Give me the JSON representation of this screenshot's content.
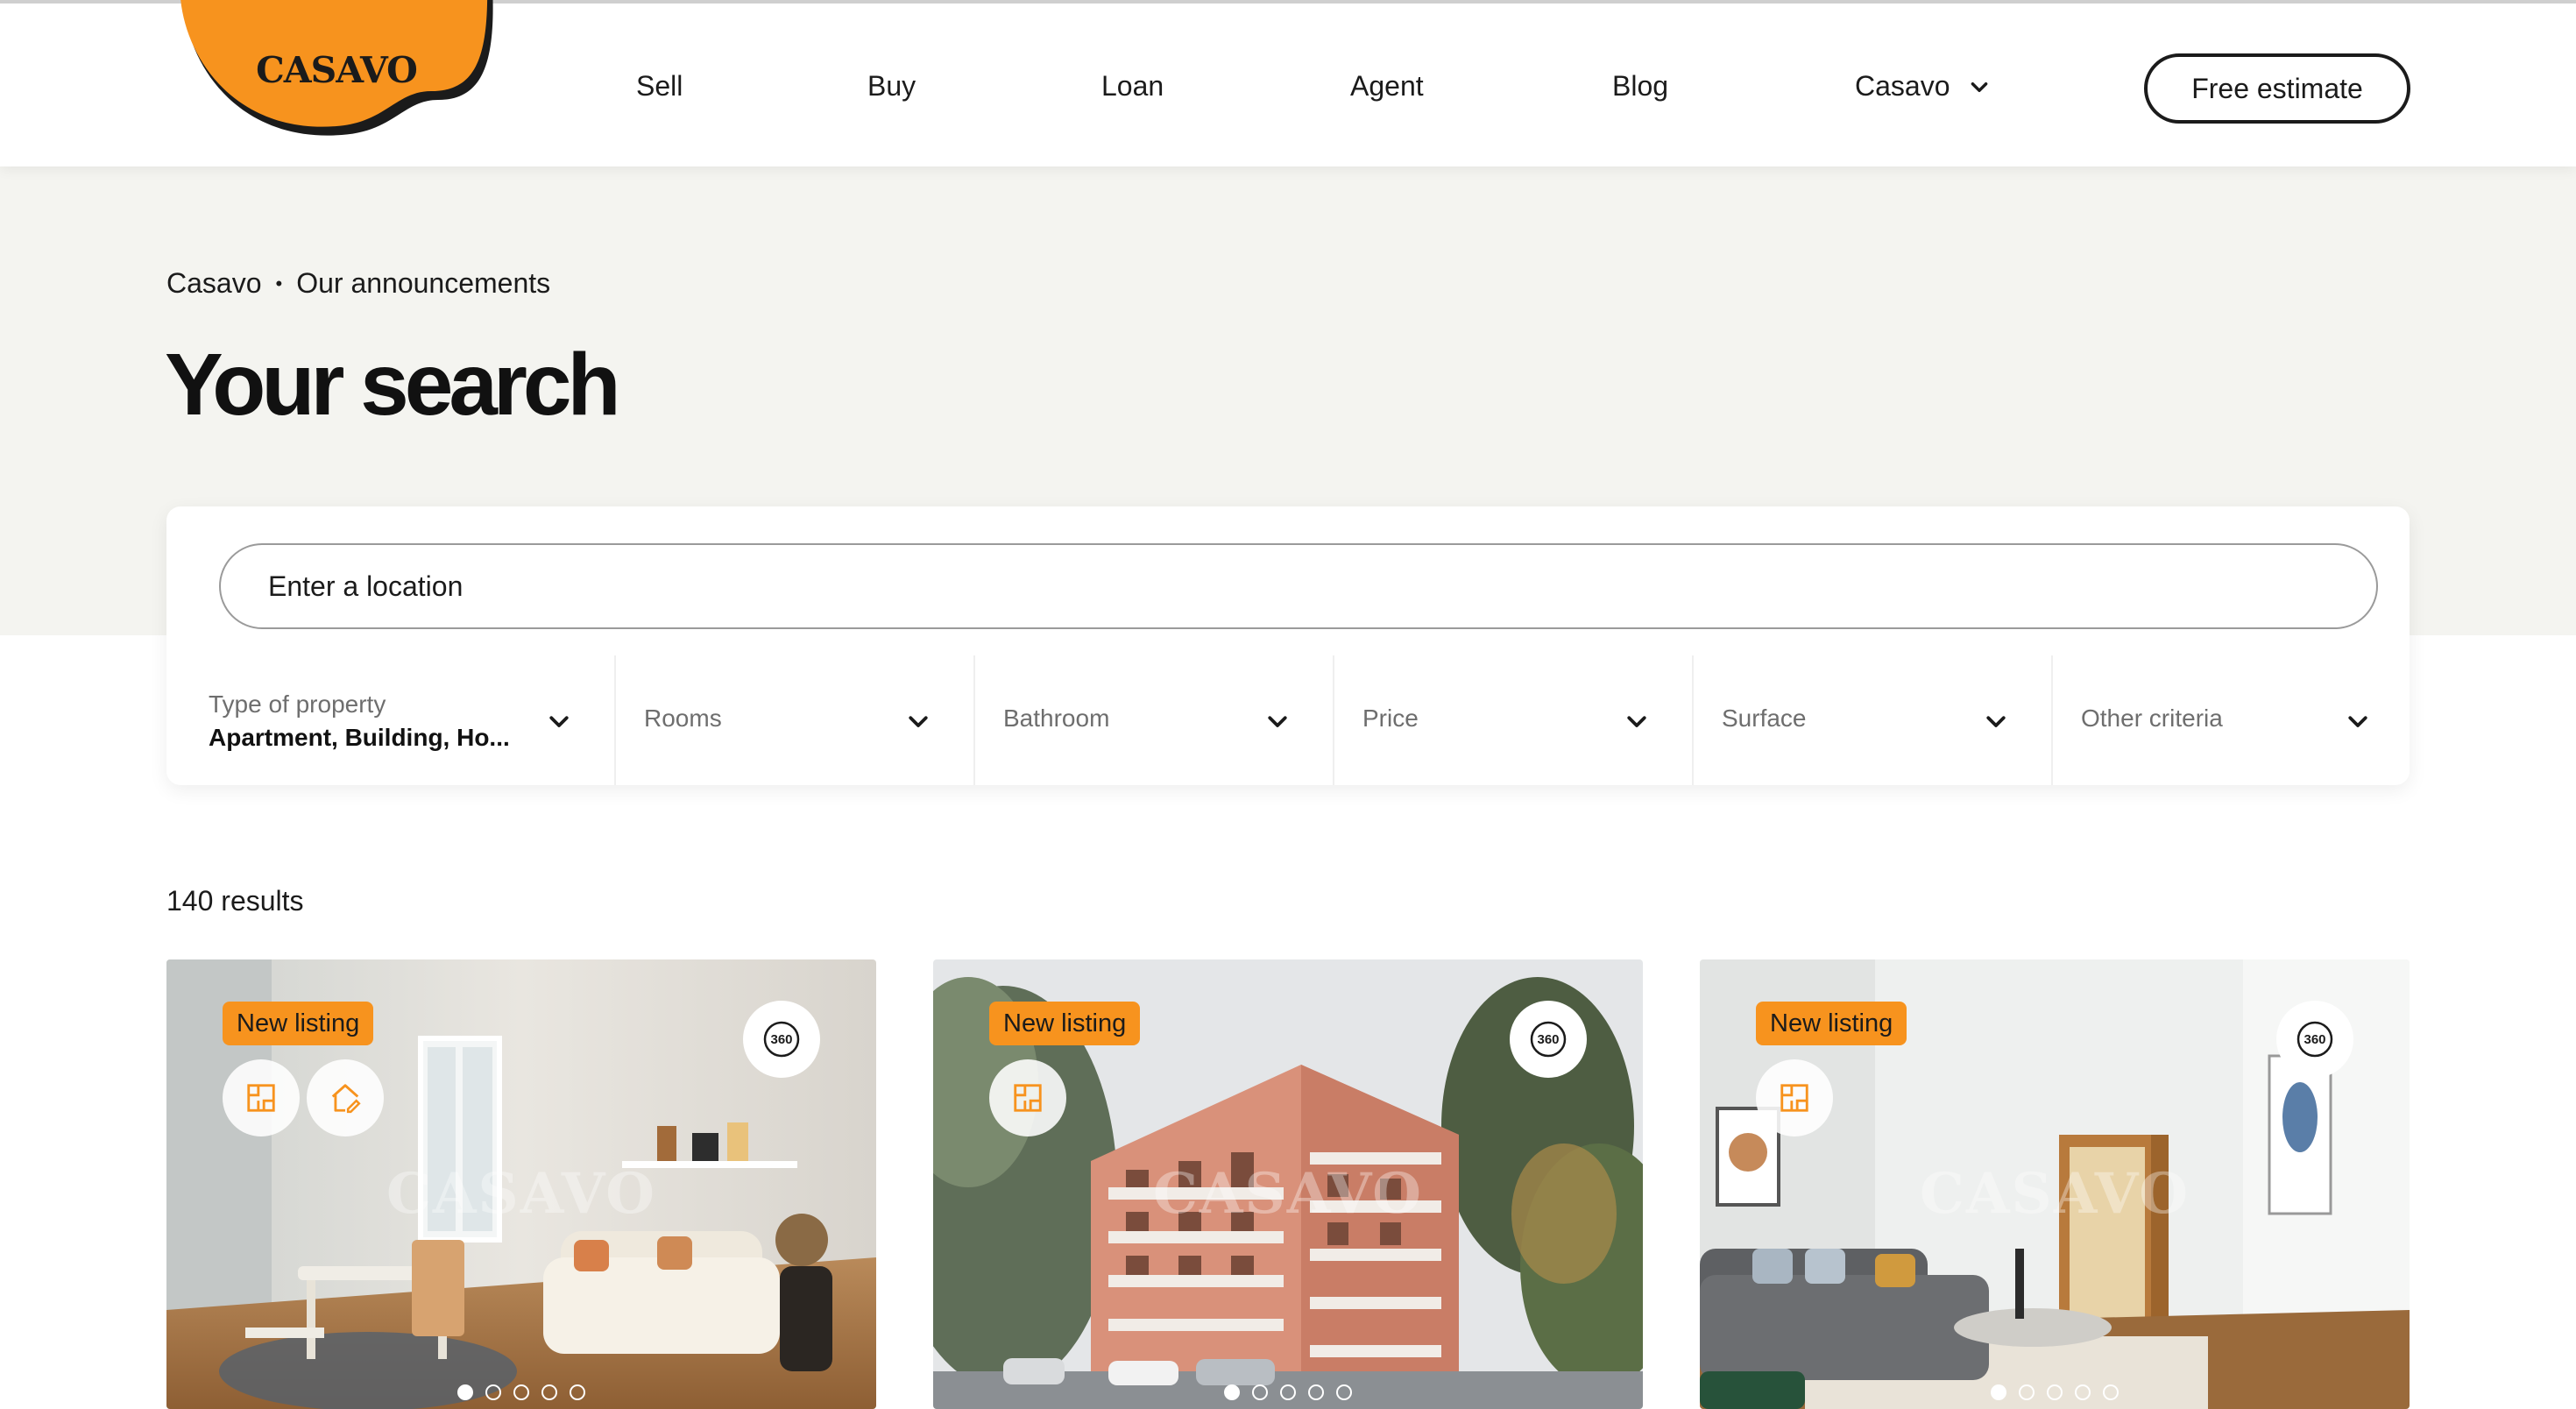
{
  "brand": {
    "logo_text": "CASAVO",
    "accent_color": "#f7931e"
  },
  "nav": {
    "items": [
      {
        "label": "Sell"
      },
      {
        "label": "Buy"
      },
      {
        "label": "Loan"
      },
      {
        "label": "Agent"
      },
      {
        "label": "Blog"
      },
      {
        "label": "Casavo",
        "icon": "chevron-down-icon"
      }
    ],
    "cta_label": "Free estimate"
  },
  "breadcrumb": {
    "items": [
      "Casavo",
      "Our announcements"
    ],
    "separator": "•"
  },
  "page_title": "Your search",
  "search": {
    "placeholder": "Enter a location",
    "filters": [
      {
        "label": "Type of property",
        "value": "Apartment, Building, Ho..."
      },
      {
        "label": "Rooms"
      },
      {
        "label": "Bathroom"
      },
      {
        "label": "Price"
      },
      {
        "label": "Surface"
      },
      {
        "label": "Other criteria"
      }
    ]
  },
  "results": {
    "count_label": "140 results",
    "listings": [
      {
        "badge": "New listing",
        "tour_label": "360",
        "watermark": "CASAVO",
        "feature_icons": [
          "floorplan-icon",
          "house-edit-icon"
        ],
        "photo_count": 5,
        "active_photo": 0
      },
      {
        "badge": "New listing",
        "tour_label": "360",
        "watermark": "CASAVO",
        "feature_icons": [
          "floorplan-icon"
        ],
        "photo_count": 5,
        "active_photo": 0
      },
      {
        "badge": "New listing",
        "tour_label": "360",
        "watermark": "CASAVO",
        "feature_icons": [
          "floorplan-icon"
        ],
        "photo_count": 5,
        "active_photo": 0
      }
    ]
  }
}
